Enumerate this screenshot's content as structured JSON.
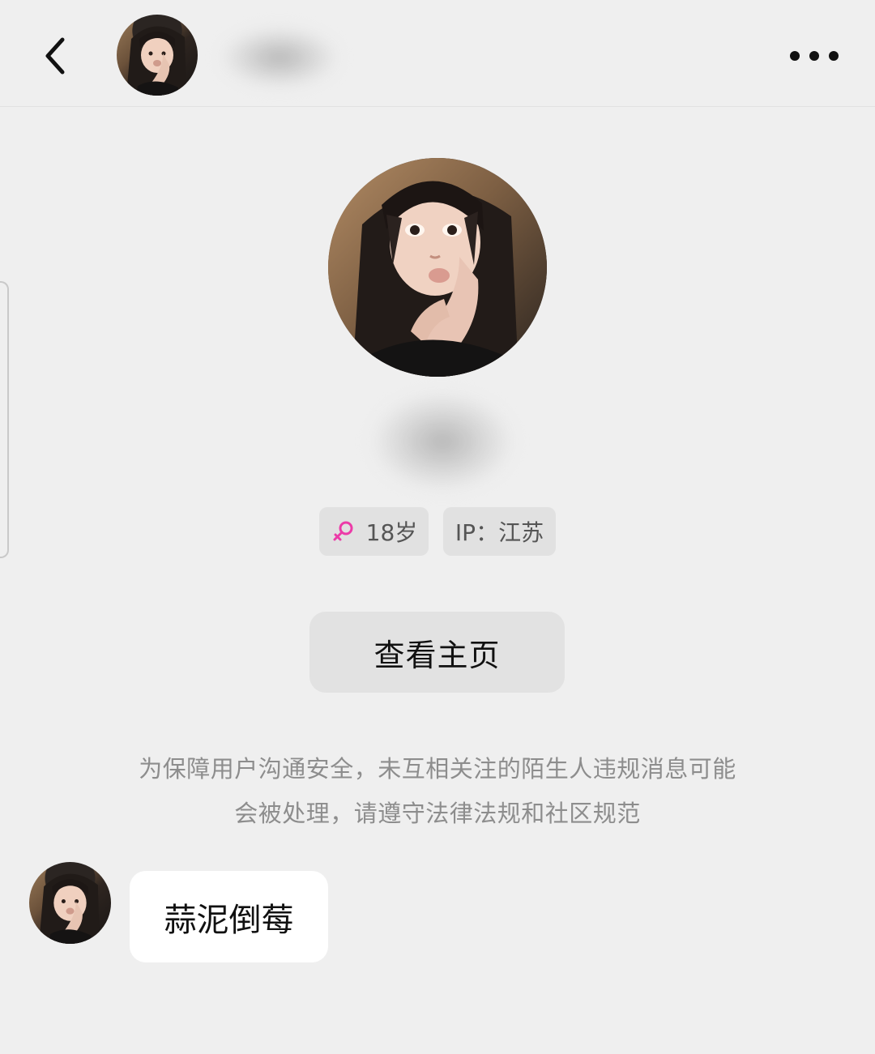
{
  "header": {
    "back_label": "返回",
    "more_label": "更多",
    "avatar_label": "用户头像"
  },
  "profile": {
    "age_text": "18岁",
    "ip_text": "IP：江苏",
    "view_profile_label": "查看主页"
  },
  "notice": {
    "line1": "为保障用户沟通安全，未互相关注的陌生人违规消息可能",
    "line2": "会被处理，请遵守法律法规和社区规范"
  },
  "messages": [
    {
      "text": "蒜泥倒莓"
    }
  ],
  "colors": {
    "background": "#efefef",
    "tag_background": "#e1e1e1",
    "button_background": "#e2e2e2",
    "bubble_background": "#ffffff",
    "gender_accent": "#ec3ba8",
    "notice_text": "#8d8d8d"
  },
  "icons": {
    "back": "chevron-left-icon",
    "more": "more-horizontal-icon",
    "gender": "female-icon"
  }
}
